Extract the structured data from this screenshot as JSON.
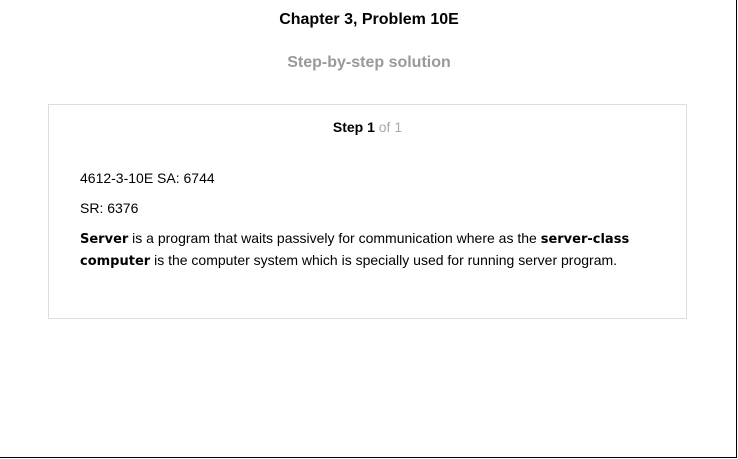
{
  "header": {
    "title": "Chapter 3, Problem 10E",
    "subtitle": "Step-by-step solution"
  },
  "step": {
    "label": "Step 1",
    "of": "of 1"
  },
  "content": {
    "line1": "4612-3-10E SA: 6744",
    "line2": "SR: 6376",
    "term1": "Server",
    "text1": " is a program that waits passively for communication where as the ",
    "term2": "server-class computer",
    "text2": " is the computer system which is specially used for running server program."
  }
}
